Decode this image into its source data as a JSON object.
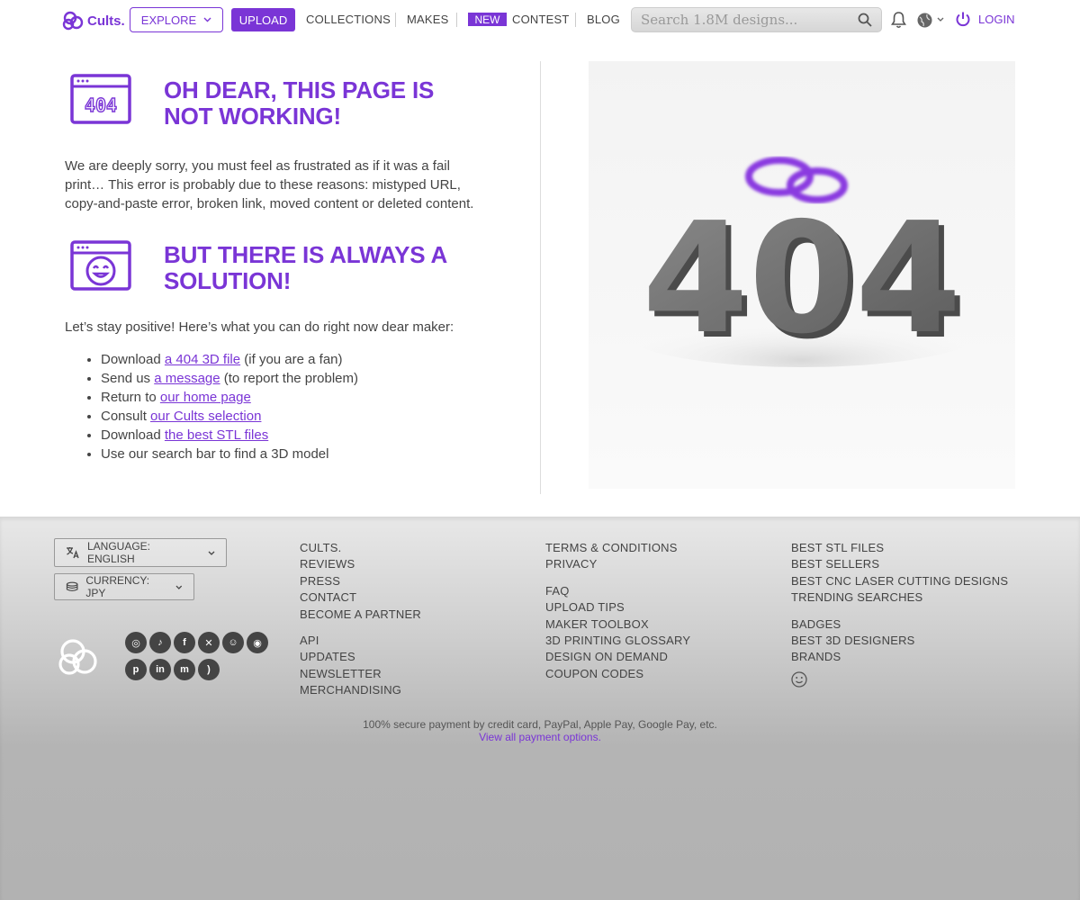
{
  "nav": {
    "logo_text": "Cults.",
    "explore_label": "EXPLORE",
    "upload_label": "UPLOAD",
    "collections_label": "COLLECTIONS",
    "makes_label": "MAKES",
    "new_badge": "NEW",
    "contest_label": "CONTEST",
    "blog_label": "BLOG",
    "search_placeholder": "Search 1.8M designs...",
    "login_label": "LOGIN"
  },
  "main": {
    "error_heading": "OH DEAR, THIS PAGE IS NOT WORKING!",
    "error_icon_text": "404",
    "error_paragraph": "We are deeply sorry, you must feel as frustrated as if it was a fail print… This error is probably due to these reasons: mistyped URL, copy-and-paste error, broken link, moved content or deleted content.",
    "solution_heading": "BUT THERE IS ALWAYS A SOLUTION!",
    "solution_intro": "Let’s stay positive! Here’s what you can do right now dear maker:",
    "solutions": [
      {
        "before": "Download ",
        "link": "a 404 3D file",
        "after": " (if you are a fan)"
      },
      {
        "before": "Send us ",
        "link": "a message",
        "after": " (to report the problem)"
      },
      {
        "before": "Return to ",
        "link": "our home page",
        "after": ""
      },
      {
        "before": "Consult ",
        "link": "our Cults selection",
        "after": ""
      },
      {
        "before": "Download ",
        "link": "the best STL files",
        "after": ""
      },
      {
        "before": "Use our search bar to find a 3D model",
        "link": "",
        "after": ""
      }
    ],
    "image_text": "404"
  },
  "footer": {
    "language_label": "LANGUAGE: ENGLISH",
    "currency_label": "CURRENCY: JPY",
    "col1": {
      "group1": [
        "CULTS.",
        "REVIEWS",
        "PRESS",
        "CONTACT",
        "BECOME A PARTNER"
      ],
      "group2": [
        "API",
        "UPDATES",
        "NEWSLETTER",
        "MERCHANDISING"
      ]
    },
    "col2": {
      "group1": [
        "TERMS & CONDITIONS",
        "PRIVACY"
      ],
      "group2": [
        "FAQ",
        "UPLOAD TIPS",
        "MAKER TOOLBOX",
        "3D PRINTING GLOSSARY",
        "DESIGN ON DEMAND",
        "COUPON CODES"
      ]
    },
    "col3": {
      "group1": [
        "BEST STL FILES",
        "BEST SELLERS",
        "BEST CNC LASER CUTTING DESIGNS",
        "TRENDING SEARCHES"
      ],
      "group2": [
        "BADGES",
        "BEST 3D DESIGNERS",
        "BRANDS"
      ]
    },
    "social_icons": [
      "instagram-icon",
      "tiktok-icon",
      "facebook-icon",
      "x-icon",
      "reddit-icon",
      "discord-icon",
      "pinterest-icon",
      "linkedin-icon",
      "mastodon-icon",
      "rss-icon"
    ],
    "payment_text": "100% secure payment by credit card, PayPal, Apple Pay, Google Pay, etc.",
    "payment_link": "View all payment options."
  },
  "colors": {
    "accent": "#7a35d6",
    "text": "#444444"
  }
}
